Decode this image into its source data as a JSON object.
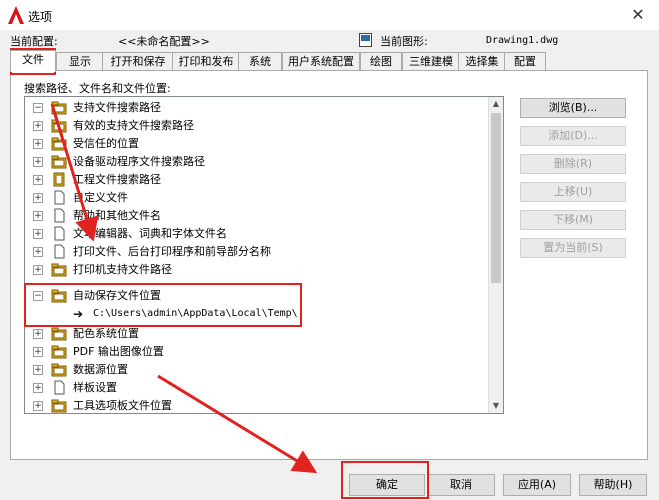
{
  "window": {
    "title": "选项",
    "close_icon": "close-icon"
  },
  "config": {
    "current_config_label": "当前配置:",
    "current_config_value": "<<未命名配置>>",
    "current_drawing_label": "当前图形:",
    "current_drawing_value": "Drawing1.dwg"
  },
  "tabs": [
    {
      "label": "文件",
      "active": true
    },
    {
      "label": "显示"
    },
    {
      "label": "打开和保存"
    },
    {
      "label": "打印和发布"
    },
    {
      "label": "系统"
    },
    {
      "label": "用户系统配置"
    },
    {
      "label": "绘图"
    },
    {
      "label": "三维建模"
    },
    {
      "label": "选择集"
    },
    {
      "label": "配置"
    }
  ],
  "panel": {
    "label": "搜索路径、文件名和文件位置:"
  },
  "tree": {
    "items": [
      {
        "label": "支持文件搜索路径",
        "icon": "folder-stack-icon",
        "expander": "−"
      },
      {
        "label": "有效的支持文件搜索路径",
        "icon": "folder-stack-icon",
        "expander": "+"
      },
      {
        "label": "受信任的位置",
        "icon": "folder-stack-icon",
        "expander": "+"
      },
      {
        "label": "设备驱动程序文件搜索路径",
        "icon": "folder-stack-icon",
        "expander": "+"
      },
      {
        "label": "工程文件搜索路径",
        "icon": "project-file-icon",
        "expander": "+"
      },
      {
        "label": "自定义文件",
        "icon": "document-icon",
        "expander": "+"
      },
      {
        "label": "帮助和其他文件名",
        "icon": "document-icon",
        "expander": "+"
      },
      {
        "label": "文本编辑器、词典和字体文件名",
        "icon": "document-icon",
        "expander": "+"
      },
      {
        "label": "打印文件、后台打印程序和前导部分名称",
        "icon": "document-icon",
        "expander": "+"
      },
      {
        "label": "打印机支持文件路径",
        "icon": "folder-stack-icon",
        "expander": "+"
      },
      {
        "label": "自动保存文件位置",
        "icon": "folder-stack-icon",
        "expander": "−"
      },
      {
        "label": "C:\\Users\\admin\\AppData\\Local\\Temp\\",
        "icon": "arrow-right-icon",
        "child": true
      },
      {
        "label": "配色系统位置",
        "icon": "folder-stack-icon",
        "expander": "+"
      },
      {
        "label": "PDF 输出图像位置",
        "icon": "folder-stack-icon",
        "expander": "+"
      },
      {
        "label": "数据源位置",
        "icon": "folder-stack-icon",
        "expander": "+"
      },
      {
        "label": "样板设置",
        "icon": "document-icon",
        "expander": "+"
      },
      {
        "label": "工具选项板文件位置",
        "icon": "folder-stack-icon",
        "expander": "+"
      }
    ]
  },
  "side_buttons": [
    {
      "label": "浏览(B)...",
      "enabled": true
    },
    {
      "label": "添加(D)...",
      "enabled": false
    },
    {
      "label": "删除(R)",
      "enabled": false
    },
    {
      "label": "上移(U)",
      "enabled": false
    },
    {
      "label": "下移(M)",
      "enabled": false
    },
    {
      "label": "置为当前(S)",
      "enabled": false
    }
  ],
  "footer": {
    "ok": "确定",
    "cancel": "取消",
    "apply": "应用(A)",
    "help": "帮助(H)"
  },
  "colors": {
    "highlight": "#e0231e",
    "folder": "#e6b422",
    "app_icon": "#d9161c"
  }
}
